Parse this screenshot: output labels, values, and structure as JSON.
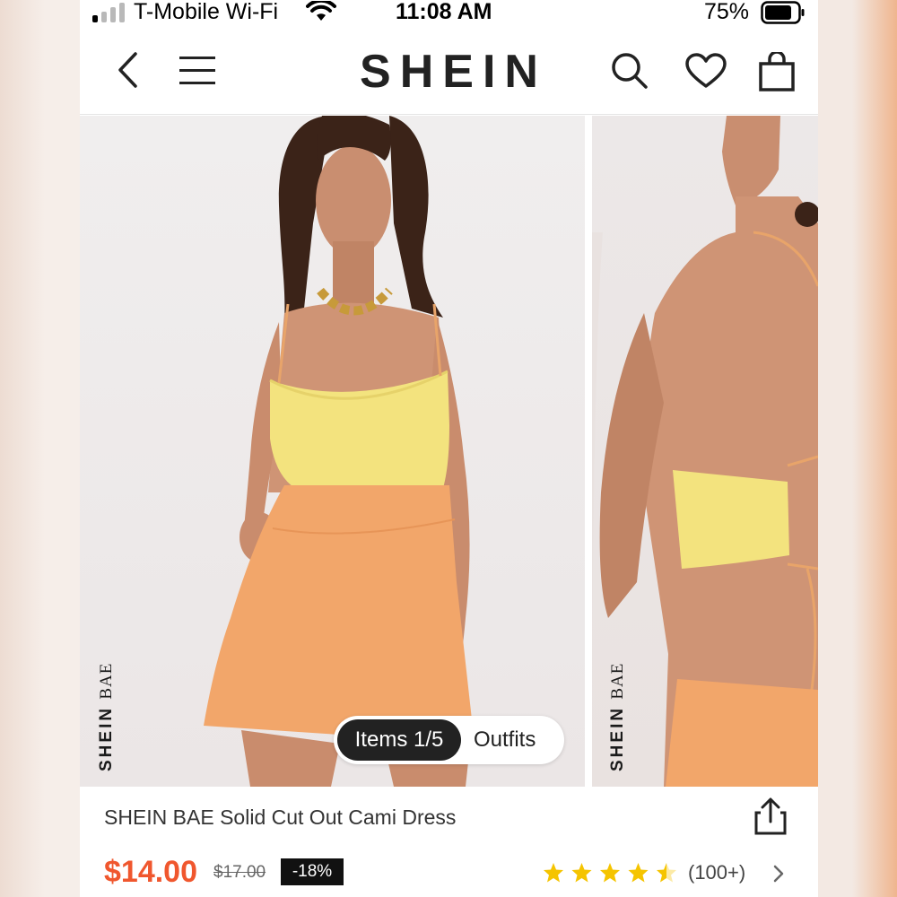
{
  "status_bar": {
    "carrier": "T-Mobile Wi-Fi",
    "time": "11:08 AM",
    "battery": "75%"
  },
  "nav": {
    "logo": "SHEIN",
    "icons": [
      "back-icon",
      "menu-icon",
      "search-icon",
      "heart-icon",
      "bag-icon"
    ]
  },
  "gallery": {
    "brand_watermark_bold": "SHEIN",
    "brand_watermark_light": "BAE",
    "items_label": "Items 1/5",
    "outfits_label": "Outfits"
  },
  "product": {
    "title": "SHEIN BAE Solid Cut Out Cami Dress",
    "price": "$14.00",
    "original_price": "$17.00",
    "discount": "-18%",
    "rating": 4.5,
    "review_count": "(100+)"
  },
  "colors": {
    "accent_price": "#f0572e",
    "star": "#f5c400",
    "top_yellow": "#f3e37e",
    "skirt_orange": "#f2a66a"
  }
}
